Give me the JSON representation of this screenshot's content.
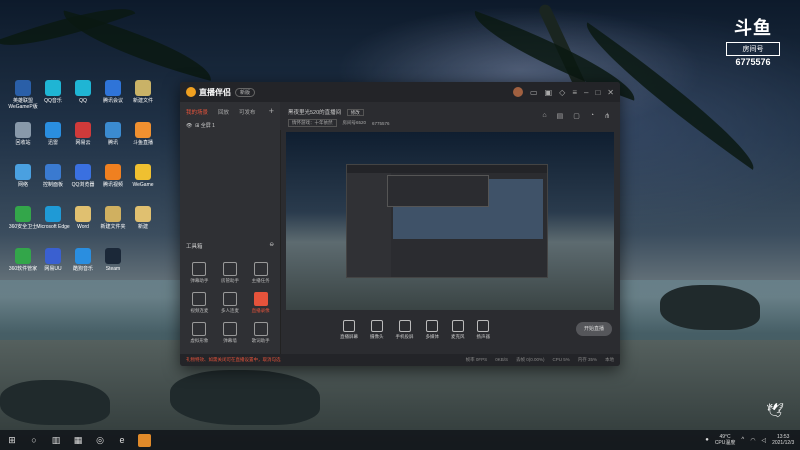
{
  "desktop": {
    "icons": [
      {
        "label": "英雄联盟\nWeGameP版",
        "color": "#2a5fa8"
      },
      {
        "label": "QQ音乐",
        "color": "#1fb5d4"
      },
      {
        "label": "QQ",
        "color": "#1fb5d4"
      },
      {
        "label": "腾讯会议",
        "color": "#2f74d8"
      },
      {
        "label": "新建文件",
        "color": "#c9b267"
      },
      {
        "label": "回收站",
        "color": "#8899aa"
      },
      {
        "label": "迅雷",
        "color": "#2a8ee0"
      },
      {
        "label": "网易云",
        "color": "#d03a3a"
      },
      {
        "label": "腾讯",
        "color": "#3b8bd0"
      },
      {
        "label": "斗鱼直播",
        "color": "#f09030"
      },
      {
        "label": "网络",
        "color": "#4aa0e0"
      },
      {
        "label": "控制面板",
        "color": "#3a7ad0"
      },
      {
        "label": "QQ浏览器",
        "color": "#3a70e0"
      },
      {
        "label": "腾讯视频",
        "color": "#f08020"
      },
      {
        "label": "WeGame",
        "color": "#f0c030"
      },
      {
        "label": "360安全卫士",
        "color": "#33a64a"
      },
      {
        "label": "Microsoft Edge",
        "color": "#1f9ad6"
      },
      {
        "label": "Word",
        "color": "#e0c070"
      },
      {
        "label": "新建文件夹",
        "color": "#d0b060"
      },
      {
        "label": "新建",
        "color": "#e0c070"
      },
      {
        "label": "360软件管家",
        "color": "#33a64a"
      },
      {
        "label": "网易UU",
        "color": "#3a60d0"
      },
      {
        "label": "酷狗音乐",
        "color": "#2a8ee0"
      },
      {
        "label": "Steam",
        "color": "#1b2838"
      }
    ]
  },
  "brand": {
    "logo": "斗鱼",
    "room_label": "房间号",
    "room_number": "6775576"
  },
  "window": {
    "title": "直播伴侣",
    "badge": "新版",
    "left_tabs": [
      "我的场景",
      "回放",
      "可发布"
    ],
    "scene_name": "全屏 1",
    "tools_title": "工具箱",
    "tools": [
      {
        "label": "弹幕助手",
        "hot": false
      },
      {
        "label": "房管助手",
        "hot": false
      },
      {
        "label": "主播任务",
        "hot": false
      },
      {
        "label": "视频连麦",
        "hot": false
      },
      {
        "label": "多人连麦",
        "hot": false
      },
      {
        "label": "直播录像",
        "hot": true
      },
      {
        "label": "虚拟形象",
        "hot": false
      },
      {
        "label": "弹幕墙",
        "hot": false
      },
      {
        "label": "歌词助手",
        "hot": false
      }
    ],
    "room_title": "黑夜里光520的直播间",
    "edit_label": "修改",
    "category": "情怀游戏：十年依然",
    "room_info": "房间号6520",
    "room_id": "6775576",
    "bottom_tools": [
      "直播屏幕",
      "摄像头",
      "手机投屏",
      "多媒体",
      "麦克风",
      "扬声器"
    ],
    "live_button": "开始直播",
    "status_warning": "礼物特效、如需关闭可在直播设置中，取消勾选",
    "status_items": [
      "帧率 0FPS",
      "0KB/S",
      "丢帧 0(0.00%)",
      "CPU 5%",
      "内存 35%",
      "本地"
    ]
  },
  "taskbar": {
    "temp": "49°C",
    "temp_label": "CPU温度",
    "time": "13:53",
    "date": "2021/12/3"
  }
}
